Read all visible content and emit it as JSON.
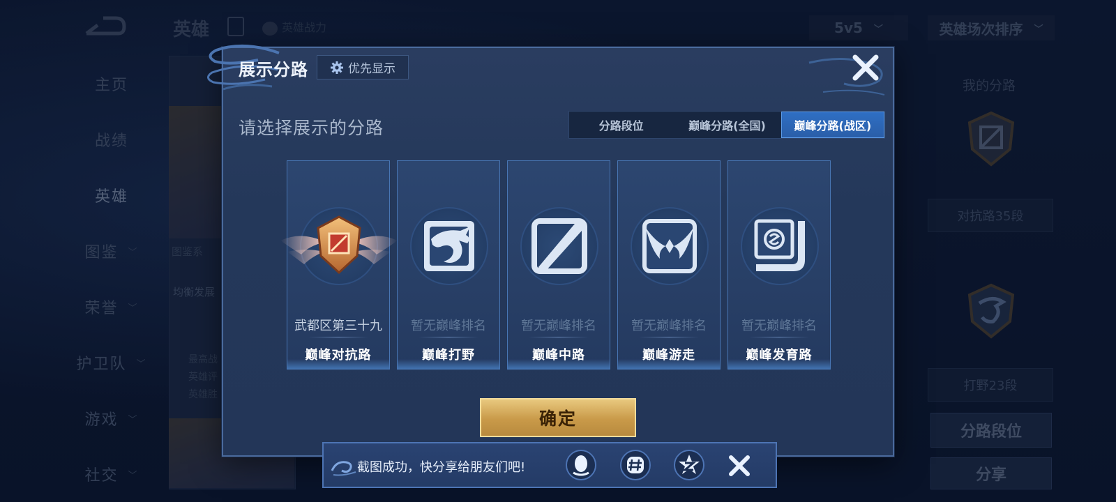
{
  "nav": {
    "items": [
      {
        "label": "主页",
        "arrow": false
      },
      {
        "label": "战绩",
        "arrow": false
      },
      {
        "label": "英雄",
        "arrow": false,
        "active": true
      },
      {
        "label": "图鉴",
        "arrow": true
      },
      {
        "label": "荣誉",
        "arrow": true
      },
      {
        "label": "护卫队",
        "arrow": true
      },
      {
        "label": "游戏",
        "arrow": true
      },
      {
        "label": "社交",
        "arrow": true
      }
    ]
  },
  "header": {
    "title": "英雄",
    "sub": "英雄战力",
    "mode_select": "5v5",
    "sort_select": "英雄场次排序"
  },
  "right_panel": {
    "my_lanes_label": "我的分路",
    "lane1_text": "对抗路35段",
    "lane2_text": "打野23段",
    "lane_rank_button": "分路段位",
    "share_button": "分享"
  },
  "background_cards": {
    "card_tag": "图鉴系",
    "card_text1": "均衡发展",
    "card_text2": "最高战",
    "card_text3": "英雄评",
    "card_text4": "英雄胜"
  },
  "modal": {
    "title": "展示分路",
    "priority_button": "优先显示",
    "prompt": "请选择展示的分路",
    "tabs": [
      "分路段位",
      "巅峰分路(全国)",
      "巅峰分路(战区)"
    ],
    "active_tab_index": 2,
    "lanes": [
      {
        "rank": "武都区第三十九",
        "name": "巅峰对抗路",
        "icon": "clash-lane-badge-icon",
        "ranked": true
      },
      {
        "rank": "暂无巅峰排名",
        "name": "巅峰打野",
        "icon": "jungle-dragon-icon",
        "ranked": false
      },
      {
        "rank": "暂无巅峰排名",
        "name": "巅峰中路",
        "icon": "mid-lane-slash-icon",
        "ranked": false
      },
      {
        "rank": "暂无巅峰排名",
        "name": "巅峰游走",
        "icon": "roam-wings-icon",
        "ranked": false
      },
      {
        "rank": "暂无巅峰排名",
        "name": "巅峰发育路",
        "icon": "farm-lane-icon",
        "ranked": false
      }
    ],
    "confirm_button": "确定"
  },
  "toast": {
    "message": "截图成功，快分享给朋友们吧!",
    "share_targets": [
      "qq-icon",
      "wechat-moments-icon",
      "qzone-icon"
    ]
  },
  "colors": {
    "accent_blue": "#2f6fc4",
    "confirm_gold": "#c99a49",
    "modal_bg": "#263a5d"
  }
}
